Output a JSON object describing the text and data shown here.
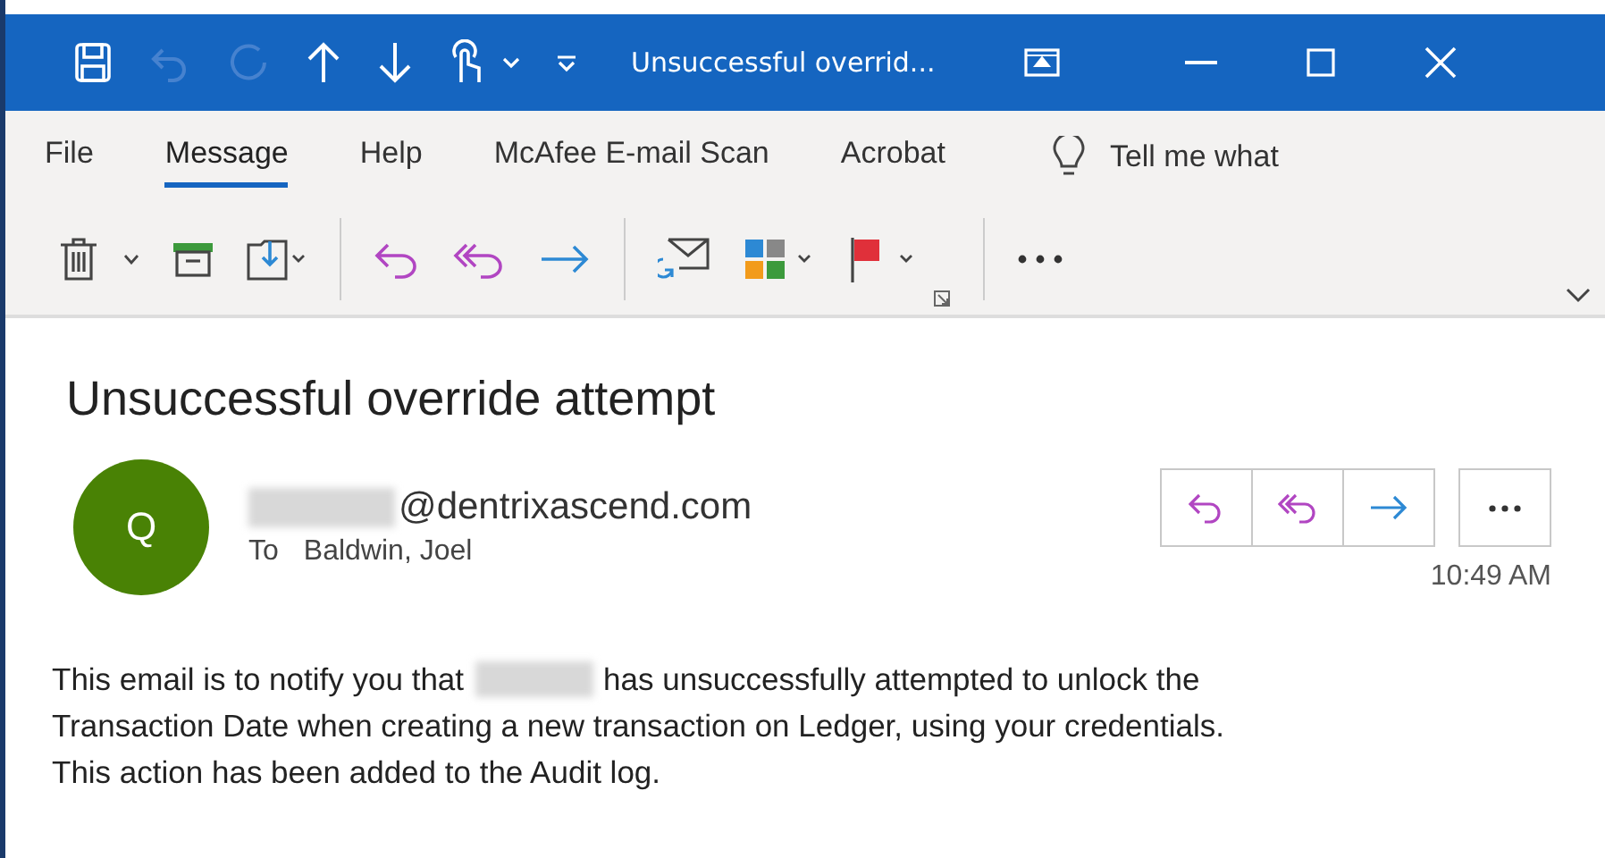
{
  "window": {
    "title": "Unsuccessful overrid..."
  },
  "menu_tabs": [
    {
      "label": "File",
      "selected": false
    },
    {
      "label": "Message",
      "selected": true
    },
    {
      "label": "Help",
      "selected": false
    },
    {
      "label": "McAfee E-mail Scan",
      "selected": false
    },
    {
      "label": "Acrobat",
      "selected": false
    }
  ],
  "tell_me": {
    "placeholder": "Tell me what"
  },
  "message": {
    "subject": "Unsuccessful override attempt",
    "avatar_initial": "Q",
    "sender_domain": "@dentrixascend.com",
    "to_label": "To",
    "recipient": "Baldwin, Joel",
    "time": "10:49 AM"
  },
  "body": {
    "lead": "This email is to notify you that",
    "lines": [
      "has unsuccessfully attempted to unlock the",
      "Transaction Date when creating a new transaction on Ledger, using your credentials.",
      "This action has been added to the Audit log."
    ]
  }
}
